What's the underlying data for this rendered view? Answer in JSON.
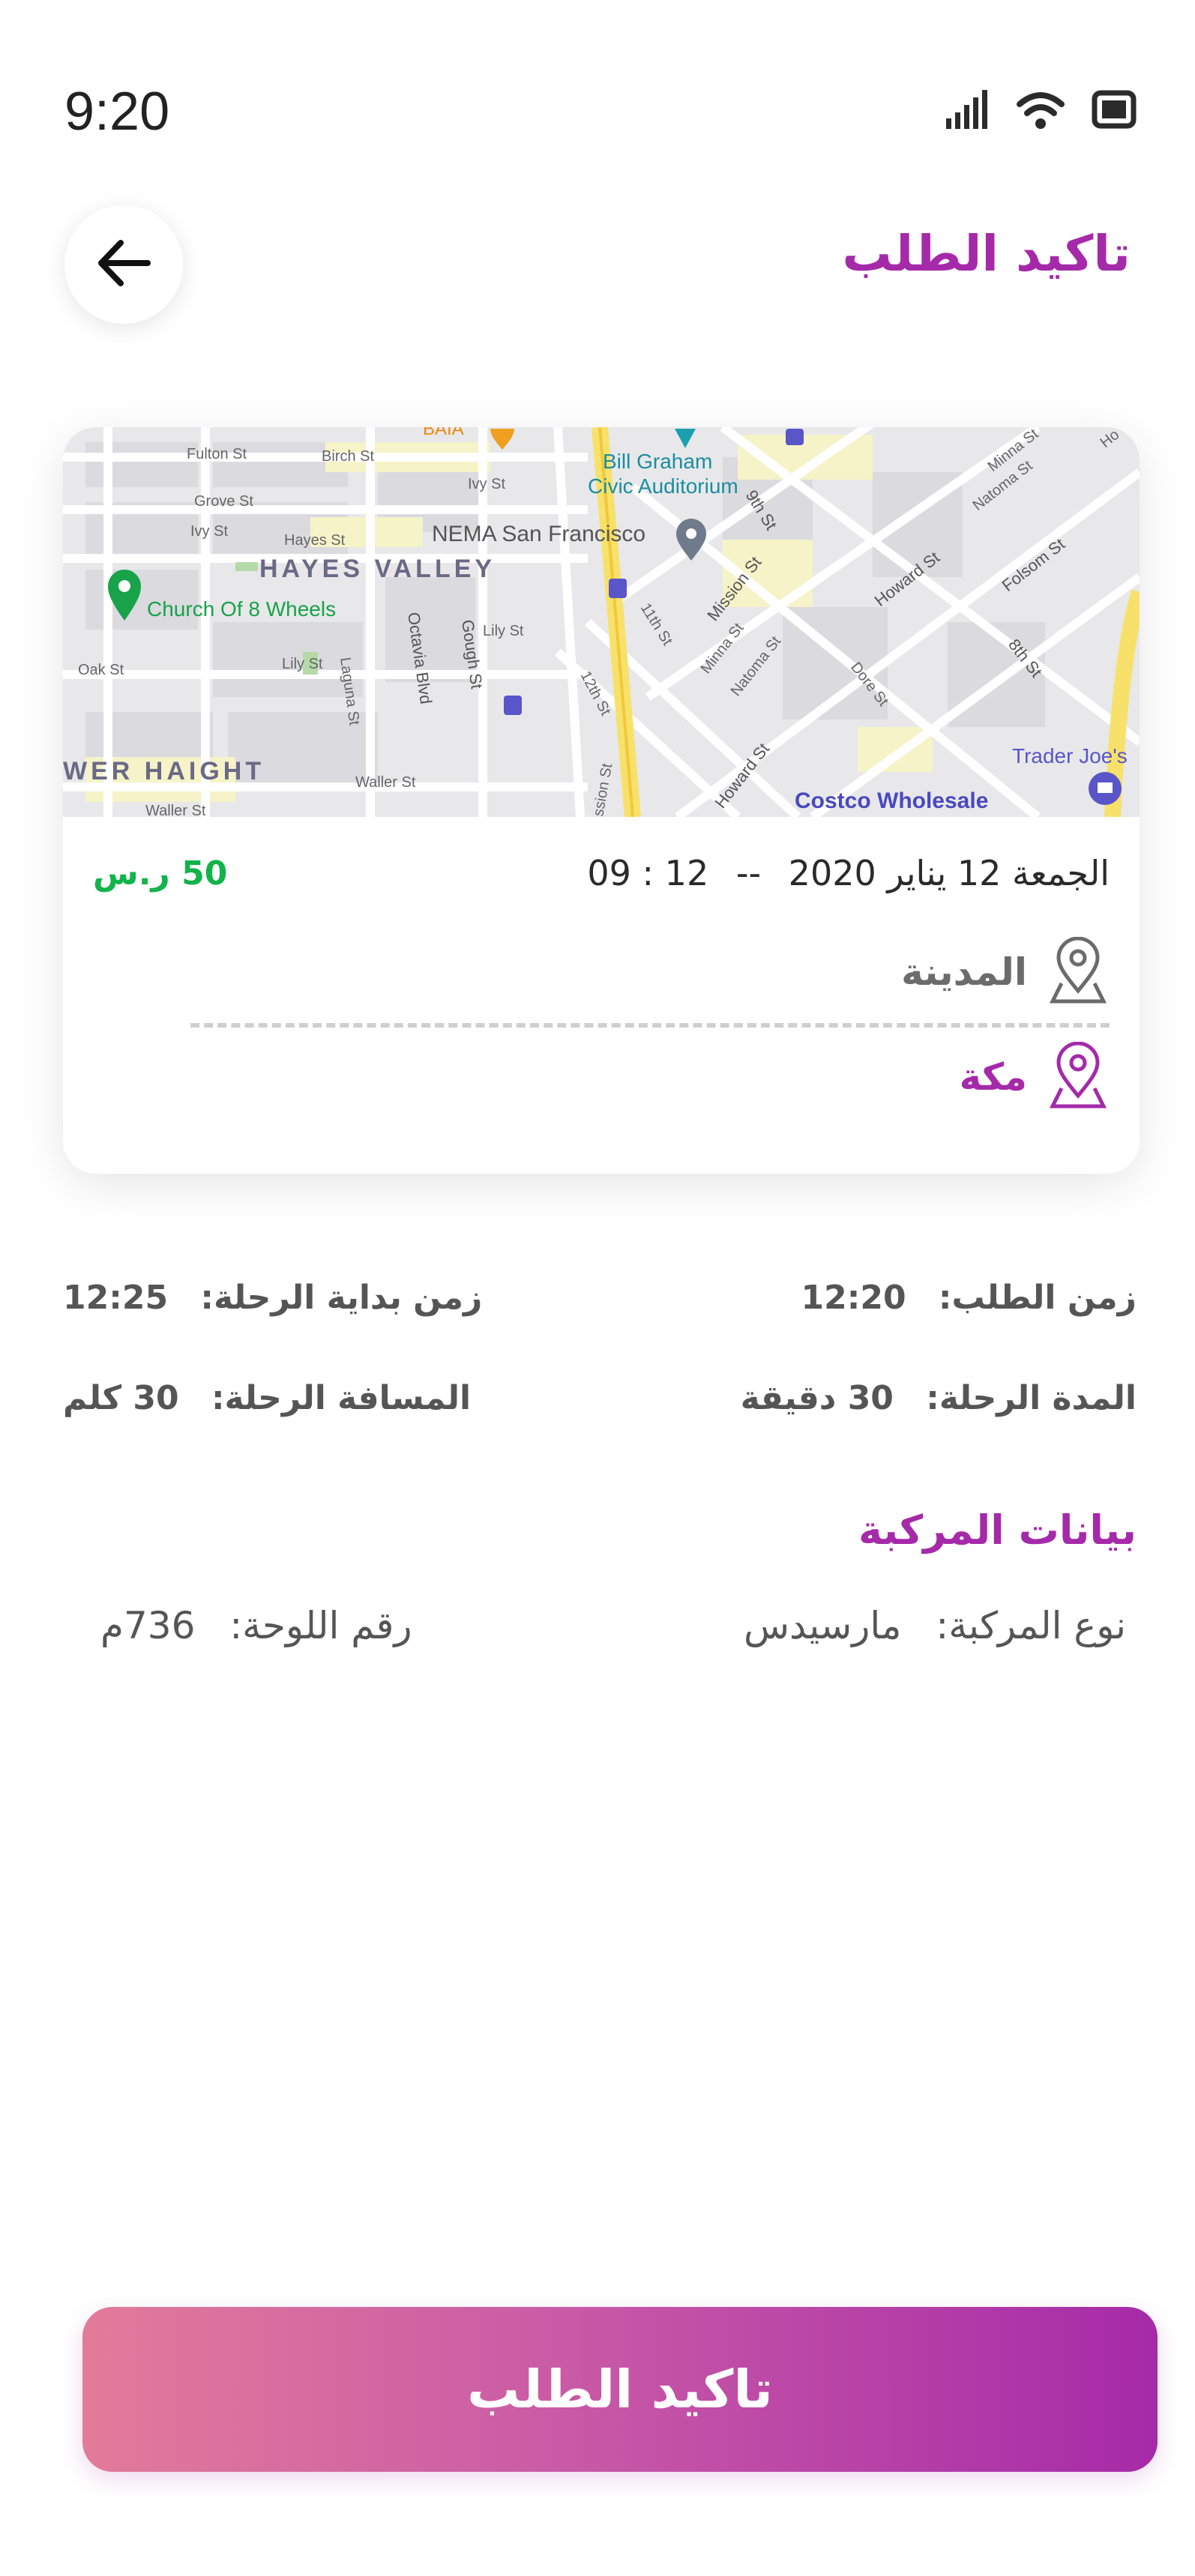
{
  "status_bar": {
    "time": "9:20"
  },
  "header": {
    "title": "تاكيد الطلب"
  },
  "map": {
    "labels": {
      "fulton": "Fulton St",
      "birch": "Birch St",
      "grove": "Grove St",
      "ivy": "Ivy St",
      "ivy2": "Ivy St",
      "hayes": "Hayes St",
      "hayes_valley": "HAYES VALLEY",
      "church": "Church Of 8 Wheels",
      "oak": "Oak St",
      "lily": "Lily St",
      "laguna": "Laguna St",
      "octavia": "Octavia Blvd",
      "gough": "Gough St",
      "lily2": "Lily St",
      "lower_haight": "WER HAIGHT",
      "waller": "Waller St",
      "waller2": "Waller St",
      "baia": "BAIA",
      "bill_graham_1": "Bill Graham",
      "bill_graham_2": "Civic Auditorium",
      "nema": "NEMA San Francisco",
      "ninth": "9th St",
      "eleventh": "11th St",
      "twelfth": "12th St",
      "mission": "Mission St",
      "mission2": "ssion St",
      "minna": "Minna St",
      "natoma": "Natoma St",
      "howard": "Howard St",
      "howard2": "Howard St",
      "dore": "Dore St",
      "folsom": "Folsom St",
      "eighth": "8th St",
      "minna2": "Minna St",
      "natoma2": "Natoma St",
      "trader": "Trader Joe's",
      "costco": "Costco Wholesale",
      "ho": "Ho"
    }
  },
  "trip": {
    "price": "50 ر.س",
    "date": "الجمعة 12 يناير 2020",
    "separator": "--",
    "time": "09 : 12",
    "from": "المدينة",
    "to": "مكة"
  },
  "details": {
    "request_time_label": "زمن الطلب:",
    "request_time_value": "12:20",
    "start_time_label": "زمن بداية الرحلة:",
    "start_time_value": "12:25",
    "duration_label": "المدة الرحلة:",
    "duration_value": "30 دقيقة",
    "distance_label": "المسافة الرحلة:",
    "distance_value": "30 كلم"
  },
  "vehicle": {
    "title": "بيانات المركبة",
    "type_label": "نوع المركبة:",
    "type_value": "مارسيدس",
    "plate_label": "رقم اللوحة:",
    "plate_value": "736م"
  },
  "confirm_button": {
    "label": "تاكيد الطلب"
  },
  "colors": {
    "accent": "#a52aa9",
    "price": "#13b34b",
    "gradient_start": "#e27b9a",
    "gradient_end": "#a62aa8"
  }
}
